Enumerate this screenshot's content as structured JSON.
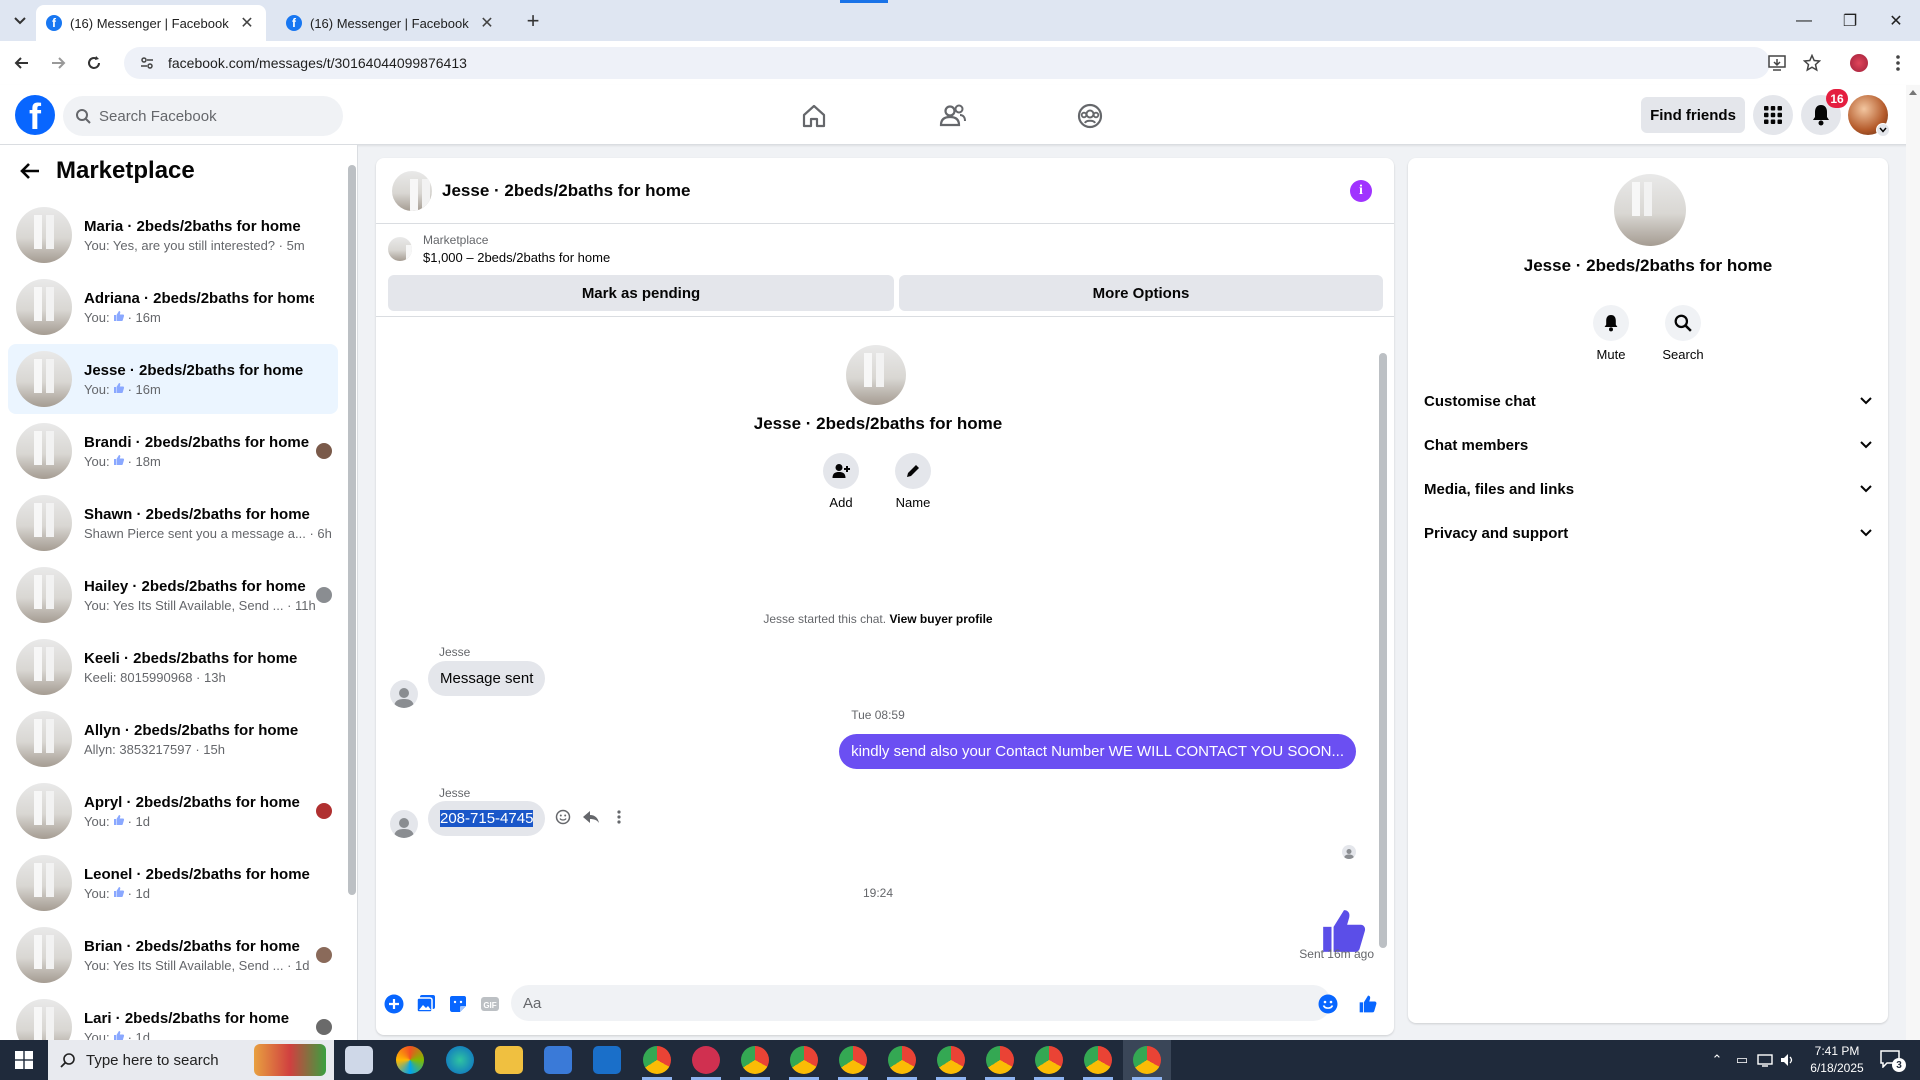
{
  "browser": {
    "tabs": [
      {
        "title": "(16) Messenger | Facebook",
        "active": true
      },
      {
        "title": "(16) Messenger | Facebook",
        "active": false
      }
    ],
    "url": "facebook.com/messages/t/30164044099876413"
  },
  "fb_header": {
    "search_placeholder": "Search Facebook",
    "find_friends_label": "Find friends",
    "notification_count": "16"
  },
  "sidebar": {
    "title": "Marketplace",
    "conversations": [
      {
        "name": "Maria · 2beds/2baths for home",
        "preview": "You: Yes, are you still interested? · 5m",
        "like": false
      },
      {
        "name": "Adriana · 2beds/2baths for home",
        "preview_prefix": "You:",
        "preview_suffix": "· 16m",
        "like": true
      },
      {
        "name": "Jesse · 2beds/2baths for home",
        "preview_prefix": "You:",
        "preview_suffix": "· 16m",
        "like": true,
        "selected": true
      },
      {
        "name": "Brandi · 2beds/2baths for home",
        "preview_prefix": "You:",
        "preview_suffix": "· 18m",
        "like": true
      },
      {
        "name": "Shawn · 2beds/2baths for home",
        "preview": "Shawn Pierce sent you a message a... · 6h",
        "like": false
      },
      {
        "name": "Hailey · 2beds/2baths for home",
        "preview": "You: Yes Its Still Available, Send ... · 11h",
        "like": false
      },
      {
        "name": "Keeli · 2beds/2baths for home",
        "preview": "Keeli: 8015990968 · 13h",
        "like": false
      },
      {
        "name": "Allyn · 2beds/2baths for home",
        "preview": "Allyn: 3853217597 · 15h",
        "like": false
      },
      {
        "name": "Apryl · 2beds/2baths for home",
        "preview_prefix": "You:",
        "preview_suffix": "· 1d",
        "like": true
      },
      {
        "name": "Leonel · 2beds/2baths for home",
        "preview_prefix": "You:",
        "preview_suffix": "· 1d",
        "like": true
      },
      {
        "name": "Brian · 2beds/2baths for home",
        "preview": "You: Yes Its Still Available, Send ... · 1d",
        "like": false
      },
      {
        "name": "Lari · 2beds/2baths for home",
        "preview_prefix": "You:",
        "preview_suffix": "· 1d",
        "like": true
      }
    ]
  },
  "chat": {
    "title": "Jesse · 2beds/2baths for home",
    "marketplace_label": "Marketplace",
    "listing": "$1,000 – 2beds/2baths for home",
    "mark_pending_label": "Mark as pending",
    "more_options_label": "More Options",
    "hero_name": "Jesse · 2beds/2baths for home",
    "add_label": "Add",
    "name_label": "Name",
    "started_text": "Jesse started this chat.",
    "view_profile_label": "View buyer profile",
    "messages": [
      {
        "sender": "Jesse",
        "text": "Message sent",
        "direction": "in"
      },
      {
        "separator": "Tue 08:59"
      },
      {
        "text": "kindly send also your Contact Number  WE WILL CONTACT YOU SOON...",
        "direction": "out"
      },
      {
        "sender": "Jesse",
        "text": "208-715-4745",
        "direction": "in",
        "selected": true
      },
      {
        "separator": "19:24"
      }
    ],
    "sent_label": "Sent 16m ago",
    "input_placeholder": "Aa"
  },
  "details": {
    "name": "Jesse · 2beds/2baths for home",
    "mute_label": "Mute",
    "search_label": "Search",
    "sections": [
      "Customise chat",
      "Chat members",
      "Media, files and links",
      "Privacy and support"
    ]
  },
  "taskbar": {
    "search_placeholder": "Type here to search",
    "time": "7:41 PM",
    "date": "6/18/2025",
    "notification_count": "3"
  },
  "colors": {
    "fb_blue": "#0866ff",
    "out_bubble": "#6b4ff2",
    "selection": "#1a57c9",
    "badge_red": "#e41e3f",
    "info_purple": "#a033ff"
  }
}
